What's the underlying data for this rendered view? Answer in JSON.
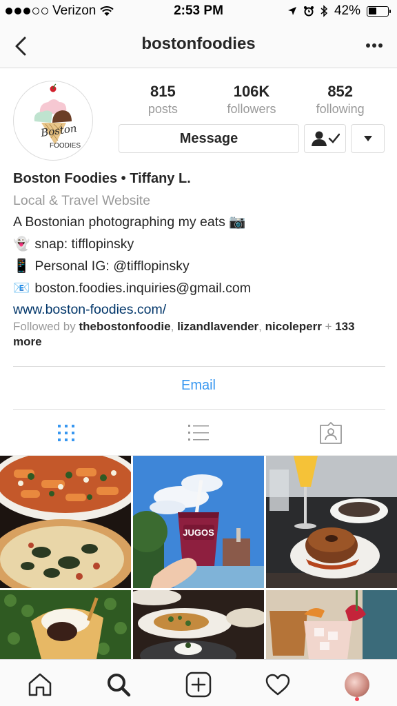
{
  "status_bar": {
    "carrier": "Verizon",
    "time": "2:53 PM",
    "battery": "42%",
    "battery_level": 0.42
  },
  "nav": {
    "title": "bostonfoodies",
    "back_icon": "chevron-left-icon",
    "more_icon": "more-dots-icon"
  },
  "profile": {
    "avatar_lines": [
      "Boston",
      "FOODIES"
    ],
    "stats": [
      {
        "value": "815",
        "label": "posts"
      },
      {
        "value": "106K",
        "label": "followers"
      },
      {
        "value": "852",
        "label": "following"
      }
    ],
    "message_label": "Message"
  },
  "bio": {
    "name": "Boston Foodies • Tiffany L.",
    "category": "Local & Travel Website",
    "lines": [
      {
        "emoji": "",
        "text": "A Bostonian photographing my eats 📷"
      },
      {
        "emoji": "👻",
        "text": "snap: tifflopinsky"
      },
      {
        "emoji": "📱",
        "text": "Personal IG: @tifflopinsky"
      },
      {
        "emoji": "📧",
        "text": "boston.foodies.inquiries@gmail.com"
      }
    ],
    "website": "www.boston-foodies.com/",
    "followed_prefix": "Followed by",
    "followed_names": [
      "thebostonfoodie",
      "lizandlavender",
      "nicoleperr"
    ],
    "followed_more": "133 more"
  },
  "email_button": "Email",
  "photos": [
    {
      "cup_label": "JUGOS"
    }
  ],
  "colors": {
    "accent": "#3897f0",
    "link": "#003569",
    "muted": "#999999",
    "border": "#dbdbdb"
  }
}
